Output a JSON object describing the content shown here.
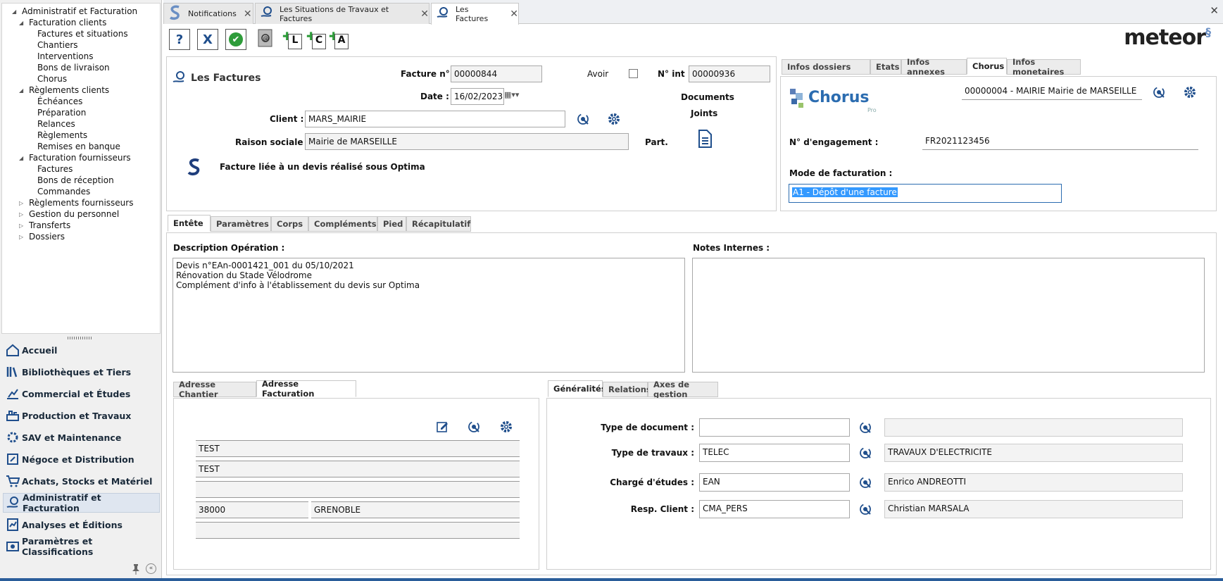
{
  "tree": [
    {
      "label": "Administratif et Facturation",
      "level": 0,
      "expanded": true
    },
    {
      "label": "Facturation clients",
      "level": 1,
      "expanded": true
    },
    {
      "label": "Factures et situations",
      "level": 2
    },
    {
      "label": "Chantiers",
      "level": 2
    },
    {
      "label": "Interventions",
      "level": 2
    },
    {
      "label": "Bons de livraison",
      "level": 2
    },
    {
      "label": "Chorus",
      "level": 2
    },
    {
      "label": "Règlements clients",
      "level": 1,
      "expanded": true
    },
    {
      "label": "Échéances",
      "level": 2
    },
    {
      "label": "Préparation",
      "level": 2
    },
    {
      "label": "Relances",
      "level": 2
    },
    {
      "label": "Règlements",
      "level": 2
    },
    {
      "label": "Remises en banque",
      "level": 2
    },
    {
      "label": "Facturation fournisseurs",
      "level": 1,
      "expanded": true
    },
    {
      "label": "Factures",
      "level": 2
    },
    {
      "label": "Bons de réception",
      "level": 2
    },
    {
      "label": "Commandes",
      "level": 2
    },
    {
      "label": "Règlements fournisseurs",
      "level": 1,
      "expanded": false
    },
    {
      "label": "Gestion du personnel",
      "level": 1,
      "expanded": false
    },
    {
      "label": "Transferts",
      "level": 1,
      "expanded": false
    },
    {
      "label": "Dossiers",
      "level": 1,
      "expanded": false
    }
  ],
  "nav": [
    {
      "label": "Accueil",
      "icon": "home-icon"
    },
    {
      "label": "Bibliothèques et Tiers",
      "icon": "library-icon"
    },
    {
      "label": "Commercial et Études",
      "icon": "commercial-icon"
    },
    {
      "label": "Production et Travaux",
      "icon": "production-icon"
    },
    {
      "label": "SAV et Maintenance",
      "icon": "maintenance-icon"
    },
    {
      "label": "Négoce et Distribution",
      "icon": "negoce-icon"
    },
    {
      "label": "Achats, Stocks et Matériel",
      "icon": "cart-icon"
    },
    {
      "label": "Administratif et Facturation",
      "icon": "billing-icon",
      "selected": true
    },
    {
      "label": "Analyses et Éditions",
      "icon": "analysis-icon"
    },
    {
      "label": "Paramètres et Classifications",
      "icon": "settings-icon"
    }
  ],
  "doc_tabs": [
    {
      "label": "Notifications"
    },
    {
      "label": "Les Situations de Travaux et Factures"
    },
    {
      "label": "Les Factures",
      "active": true
    }
  ],
  "toolbar": {
    "help": "?",
    "cancel": "X",
    "validate": "✔",
    "add_l": "L",
    "add_c": "C",
    "add_a": "A"
  },
  "logo": "meteor",
  "header": {
    "title": "Les Factures",
    "facture_label": "Facture n°",
    "facture_value": "00000844",
    "avoir_label": "Avoir",
    "nint_label": "N° int :",
    "nint_value": "00000936",
    "date_label": "Date :",
    "date_value": "16/02/2023",
    "documents_label": "Documents",
    "joints_label": "Joints",
    "client_label": "Client :",
    "client_value": "MARS_MAIRIE",
    "raison_label": "Raison sociale :",
    "raison_value": "Mairie de MARSEILLE",
    "part_label": "Part.",
    "devis_note": "Facture liée à un devis réalisé sous Optima"
  },
  "right_tabs": [
    "Infos dossiers",
    "Etats",
    "Infos annexes",
    "Chorus",
    "Infos monetaires"
  ],
  "chorus": {
    "logo_text": "Chorus",
    "logo_sub": "Pro",
    "structure_value": "00000004 - MAIRIE Mairie de MARSEILLE",
    "engagement_label": "N° d'engagement :",
    "engagement_value": "FR2021123456",
    "mode_label": "Mode de facturation :",
    "mode_value": "A1 - Dépôt d'une facture"
  },
  "main_tabs": [
    "Entête",
    "Paramètres",
    "Corps",
    "Compléments",
    "Pied",
    "Récapitulatif"
  ],
  "entete": {
    "desc_label": "Description Opération :",
    "desc_value": "Devis n°EAn-0001421_001 du 05/10/2021\nRénovation du Stade Vélodrome\nComplément d'info à l'établissement du devis sur Optima",
    "notes_label": "Notes Internes :",
    "notes_value": ""
  },
  "address_tabs": [
    "Adresse Chantier",
    "Adresse Facturation"
  ],
  "address": {
    "line1": "TEST",
    "line2": "TEST",
    "line3": "",
    "zip": "38000",
    "city": "GRENOBLE",
    "line5": ""
  },
  "general_tabs": [
    "Généralités",
    "Relations",
    "Axes de gestion"
  ],
  "general": {
    "type_doc_label": "Type de document :",
    "type_doc_code": "",
    "type_doc_name": "",
    "type_trav_label": "Type de travaux :",
    "type_trav_code": "TELEC",
    "type_trav_name": "TRAVAUX D'ELECTRICITE",
    "charge_label": "Chargé d'études :",
    "charge_code": "EAN",
    "charge_name": "Enrico ANDREOTTI",
    "resp_label": "Resp. Client :",
    "resp_code": "CMA_PERS",
    "resp_name": "Christian MARSALA"
  },
  "colors": {
    "accent": "#1f4e8c",
    "selection": "#3399ff",
    "chorus_blue": "#2b6cb0"
  }
}
